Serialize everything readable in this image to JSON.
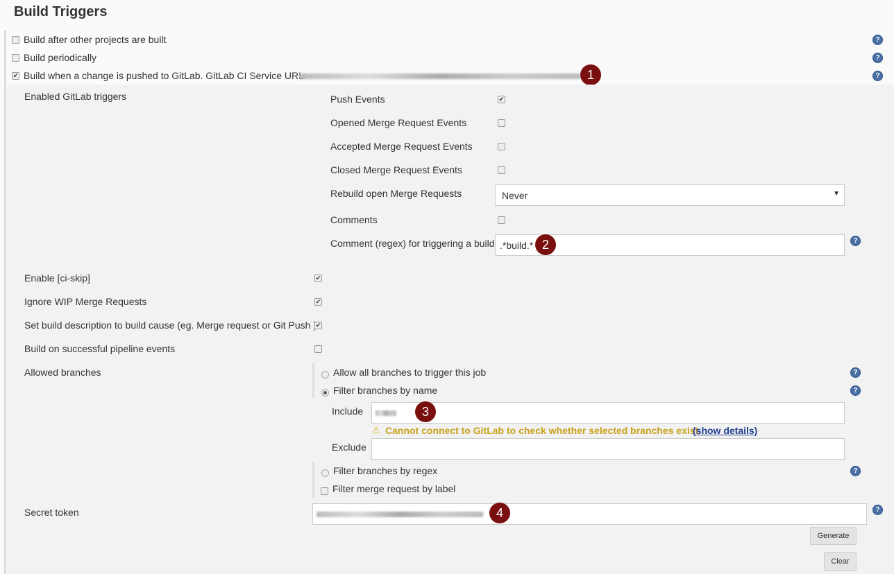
{
  "title": "Build Triggers",
  "triggers": [
    {
      "label": "Build after other projects are built",
      "checked": false
    },
    {
      "label": "Build periodically",
      "checked": false
    },
    {
      "label": "Build when a change is pushed to GitLab. GitLab CI Service URL:",
      "checked": true
    }
  ],
  "gitlab": {
    "enabled_label": "Enabled GitLab triggers",
    "push": "Push Events",
    "opened_mr": "Opened Merge Request Events",
    "accepted_mr": "Accepted Merge Request Events",
    "closed_mr": "Closed Merge Request Events",
    "rebuild": "Rebuild open Merge Requests",
    "rebuild_value": "Never",
    "comments": "Comments",
    "comment_regex": "Comment (regex) for triggering a build",
    "comment_regex_value": ".*build.*",
    "ci_skip": "Enable [ci-skip]",
    "ignore_wip": "Ignore WIP Merge Requests",
    "set_desc": "Set build description to build cause (eg. Merge request or Git Push )",
    "pipeline": "Build on successful pipeline events",
    "allowed_branches": "Allowed branches",
    "allow_all": "Allow all branches to trigger this job",
    "filter_name": "Filter branches by name",
    "include": "Include",
    "warning": "Cannot connect to GitLab to check whether selected branches exist.",
    "show_details": "(show details)",
    "exclude": "Exclude",
    "filter_regex": "Filter branches by regex",
    "filter_label": "Filter merge request by label",
    "secret_token": "Secret token",
    "generate": "Generate",
    "clear": "Clear"
  },
  "badges": [
    "1",
    "2",
    "3",
    "4"
  ],
  "colors": {
    "badge": "#7a0f0f",
    "warning": "#c8a21a",
    "link": "#1f3f8f",
    "help": "#4a6fa5"
  }
}
